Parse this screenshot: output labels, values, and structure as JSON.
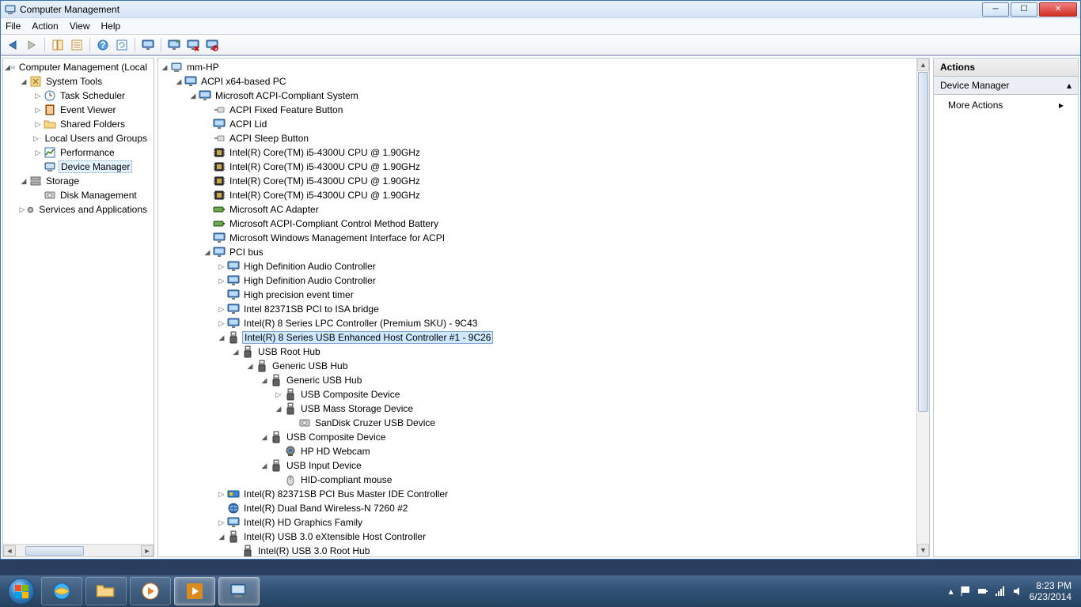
{
  "window": {
    "title": "Computer Management"
  },
  "menus": {
    "file": "File",
    "action": "Action",
    "view": "View",
    "help": "Help"
  },
  "leftTree": {
    "root": "Computer Management (Local",
    "systemTools": "System Tools",
    "taskScheduler": "Task Scheduler",
    "eventViewer": "Event Viewer",
    "sharedFolders": "Shared Folders",
    "localUsers": "Local Users and Groups",
    "performance": "Performance",
    "deviceManager": "Device Manager",
    "storage": "Storage",
    "diskManagement": "Disk Management",
    "services": "Services and Applications"
  },
  "centerTree": {
    "root": "mm-HP",
    "acpiPc": "ACPI x64-based PC",
    "msAcpi": "Microsoft ACPI-Compliant System",
    "ffButton": "ACPI Fixed Feature Button",
    "lid": "ACPI Lid",
    "sleep": "ACPI Sleep Button",
    "cpu": "Intel(R) Core(TM) i5-4300U CPU @ 1.90GHz",
    "acAdapter": "Microsoft AC Adapter",
    "battery": "Microsoft ACPI-Compliant Control Method Battery",
    "wmi": "Microsoft Windows Management Interface for ACPI",
    "pciBus": "PCI bus",
    "hdaudio": "High Definition Audio Controller",
    "hpet": "High precision event timer",
    "isaBridge": "Intel 82371SB PCI to ISA bridge",
    "lpc": "Intel(R) 8 Series LPC Controller (Premium SKU) - 9C43",
    "usbEhc": "Intel(R) 8 Series USB Enhanced Host Controller #1 - 9C26",
    "usbRootHub": "USB Root Hub",
    "genHub": "Generic USB Hub",
    "usbComposite": "USB Composite Device",
    "usbMass": "USB Mass Storage Device",
    "sandisk": "SanDisk Cruzer USB Device",
    "webcam": "HP HD Webcam",
    "usbInput": "USB Input Device",
    "hidMouse": "HID-compliant mouse",
    "ide": "Intel(R) 82371SB PCI Bus Master IDE Controller",
    "wireless": "Intel(R) Dual Band Wireless-N 7260 #2",
    "hdGraphics": "Intel(R) HD Graphics Family",
    "usb3": "Intel(R) USB 3.0 eXtensible Host Controller",
    "usb3Root": "Intel(R) USB 3.0 Root Hub"
  },
  "actions": {
    "header": "Actions",
    "section": "Device Manager",
    "more": "More Actions"
  },
  "taskbar": {
    "time": "8:23 PM",
    "date": "6/23/2014"
  }
}
